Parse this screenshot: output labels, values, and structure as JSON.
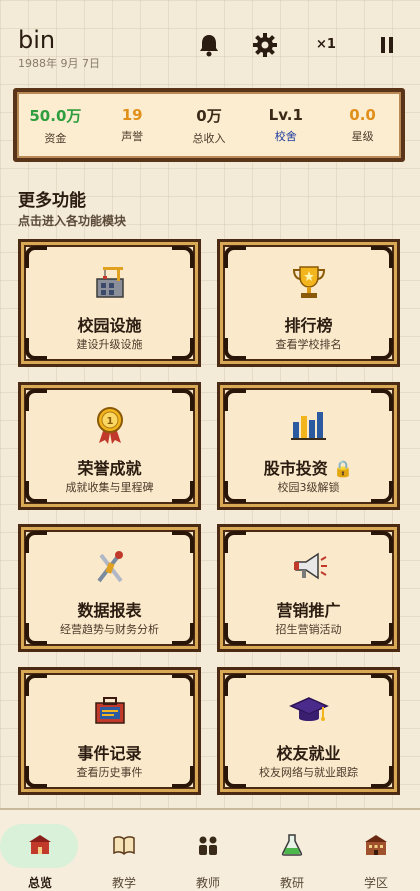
{
  "header": {
    "player_name": "bin",
    "date": "1988年 9月 7日",
    "speed": "×1"
  },
  "stats": [
    {
      "value": "50.0万",
      "label": "资金",
      "value_color": "#2e9e3e",
      "label_color": "#4a3a2a"
    },
    {
      "value": "19",
      "label": "声誉",
      "value_color": "#e0901a",
      "label_color": "#4a3a2a"
    },
    {
      "value": "0万",
      "label": "总收入",
      "value_color": "#3b2a18",
      "label_color": "#4a3a2a"
    },
    {
      "value": "Lv.1",
      "label": "校舍",
      "value_color": "#3b2a18",
      "label_color": "#1a3aa0"
    },
    {
      "value": "0.0",
      "label": "星级",
      "value_color": "#e0901a",
      "label_color": "#4a3a2a"
    }
  ],
  "section": {
    "title": "更多功能",
    "subtitle": "点击进入各功能模块"
  },
  "cards": [
    {
      "title": "校园设施",
      "subtitle": "建设升级设施",
      "icon": "construction-icon"
    },
    {
      "title": "排行榜",
      "subtitle": "查看学校排名",
      "icon": "trophy-icon"
    },
    {
      "title": "荣誉成就",
      "subtitle": "成就收集与里程碑",
      "icon": "medal-icon"
    },
    {
      "title": "股市投资 🔒",
      "subtitle": "校园3级解锁",
      "icon": "stock-icon"
    },
    {
      "title": "数据报表",
      "subtitle": "经营趋势与财务分析",
      "icon": "tools-icon"
    },
    {
      "title": "营销推广",
      "subtitle": "招生营销活动",
      "icon": "megaphone-icon"
    },
    {
      "title": "事件记录",
      "subtitle": "查看历史事件",
      "icon": "toolbox-icon"
    },
    {
      "title": "校友就业",
      "subtitle": "校友网络与就业跟踪",
      "icon": "graduation-cap-icon"
    }
  ],
  "nav": [
    {
      "label": "总览",
      "icon": "school-icon",
      "active": true
    },
    {
      "label": "教学",
      "icon": "book-icon",
      "active": false
    },
    {
      "label": "教师",
      "icon": "teachers-icon",
      "active": false
    },
    {
      "label": "教研",
      "icon": "flask-icon",
      "active": false
    },
    {
      "label": "学区",
      "icon": "district-icon",
      "active": false
    }
  ],
  "colors": {
    "accent_green": "#2e9e3e",
    "accent_orange": "#e0901a",
    "frame_brown": "#4a2a12",
    "frame_gold": "#d9a955"
  }
}
